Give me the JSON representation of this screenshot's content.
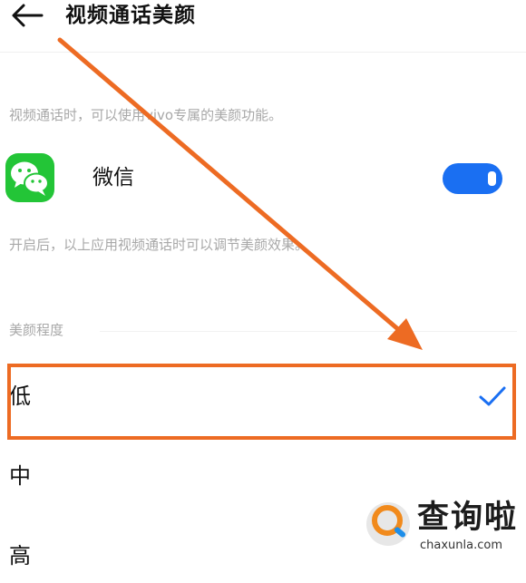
{
  "header": {
    "title": "视频通话美颜",
    "back_icon": "arrow-left-icon"
  },
  "intro_text": "视频通话时，可以使用vivo专属的美颜功能。",
  "app_row": {
    "icon": "wechat-icon",
    "name": "微信",
    "toggle_on": true,
    "accent": "#1a6ff2"
  },
  "app_hint": "开启后，以上应用视频通话时可以调节美颜效果。",
  "beauty_level": {
    "label": "美颜程度",
    "options": [
      {
        "label": "低",
        "selected": true
      },
      {
        "label": "中",
        "selected": false
      },
      {
        "label": "高",
        "selected": false
      }
    ]
  },
  "annotation": {
    "color": "#ed6b23"
  },
  "watermark": {
    "main": "查询啦",
    "sub": "chaxunla.com"
  }
}
